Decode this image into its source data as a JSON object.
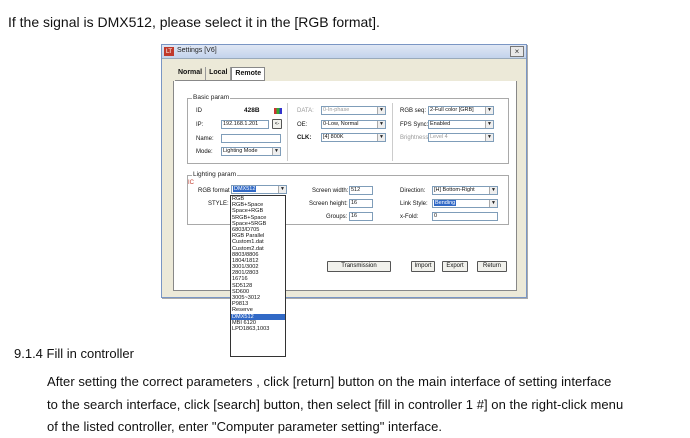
{
  "doc": {
    "intro": "If the signal is DMX512, please select it in the [RGB format].",
    "section": "9.1.4 Fill in controller",
    "para_lines": [
      "After setting the correct parameters , click [return] button on the main interface of setting interface",
      "to the search interface, click [search] button, then select [fill in controller 1 #] on the right-click menu",
      "of the listed controller, enter \"Computer parameter setting\" interface."
    ]
  },
  "window": {
    "title": "Settings [V6]",
    "icon_text": "LT",
    "close": "×",
    "tabs": [
      "Normal",
      "Local",
      "Remote"
    ],
    "active_tab": "Remote"
  },
  "basic": {
    "legend": "Basic param",
    "id_label": "ID",
    "id_value": "428B",
    "ip_label": "IP:",
    "ip_value": "192.168.1.201",
    "ip_btn": "<-",
    "name_label": "Name:",
    "name_value": "",
    "mode_label": "Mode:",
    "mode_value": "Lighting Mode",
    "data_label": "DATA:",
    "data_value": "0-In-phase",
    "oe_label": "OE:",
    "oe_value": "0-Low, Normal",
    "clk_label": "CLK:",
    "clk_value": "[4] 800K",
    "rgbseq_label": "RGB seq:",
    "rgbseq_value": "2-Full color [GRB]",
    "fps_label": "FPS Sync:",
    "fps_value": "Enabled",
    "bright_label": "Brightness:",
    "bright_value": "Level 4"
  },
  "lighting": {
    "legend": "Lighting param",
    "ic_label": "IC",
    "rgbfmt_label": "RGB format",
    "rgbfmt_value": "DMX512",
    "style_label": "STYLE:",
    "sw_label": "Screen width:",
    "sw_value": "512",
    "sh_label": "Screen height:",
    "sh_value": "16",
    "groups_label": "Groups:",
    "groups_value": "16",
    "dir_label": "Direction:",
    "dir_value": "[H] Bottom-Right",
    "link_label": "Link Style:",
    "link_value": "Bending",
    "xfold_label": "x-Fold:",
    "xfold_value": "0"
  },
  "buttons": {
    "transmission": "Transmission",
    "import": "Import",
    "export": "Export",
    "return": "Return"
  },
  "style_options": [
    "RGB",
    "RGB+Space",
    "Space+RGB",
    "5RGB+Space",
    "Space+5RGB",
    "6803/D705",
    "RGB Parallel",
    "Custom1.dat",
    "Custom2.dat",
    "8803/8806",
    "1804/1812",
    "3001/3002",
    "2801/2803",
    "16716",
    "SD5128",
    "SD600",
    "3005~3012",
    "P9813",
    "Reserve",
    "DMX512",
    "MBI 6120",
    "LPD1863,1003"
  ],
  "highlighted_option": "DMX512"
}
